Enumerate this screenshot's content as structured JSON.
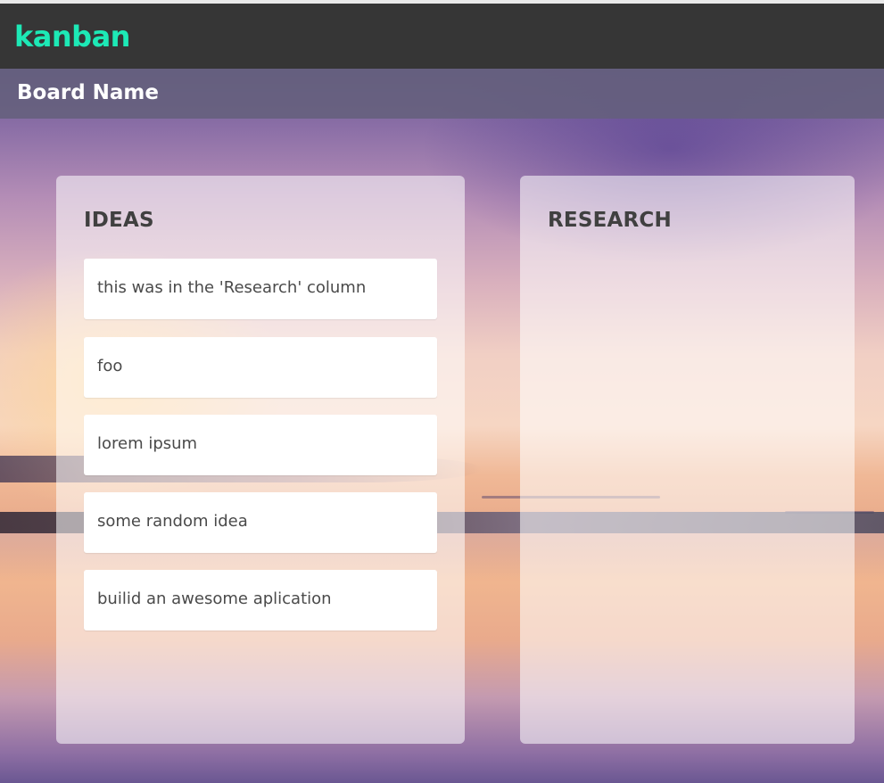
{
  "app": {
    "title": "kanban",
    "accent": "#1de9b6"
  },
  "board": {
    "name": "Board Name"
  },
  "columns": [
    {
      "title": "IDEAS",
      "cards": [
        "this was in the 'Research' column",
        "foo",
        "lorem ipsum",
        "some random idea",
        "builid an awesome aplication"
      ]
    },
    {
      "title": "RESEARCH",
      "cards": []
    }
  ]
}
